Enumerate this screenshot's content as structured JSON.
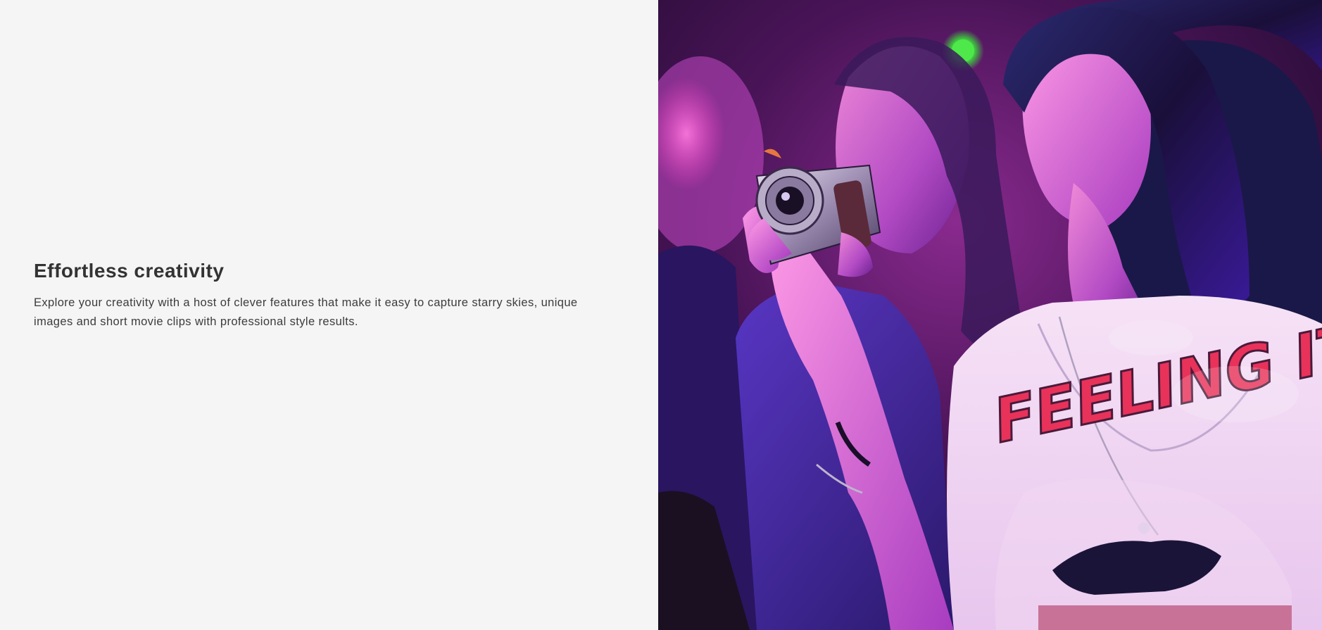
{
  "feature": {
    "title": "Effortless creativity",
    "body": "Explore your creativity with a host of clever features that make it easy to capture starry skies, unique images and short movie clips with professional style results."
  },
  "image": {
    "alt": "Woman at a concert holding a compact camera, lit by pink and purple stage lights",
    "shirt_print": "FEELING IT"
  },
  "colors": {
    "page_background": "#f4f5f4",
    "heading": "#333333",
    "body_text": "#3c3c3c",
    "stage_pink": "#ff3fc8",
    "stage_purple": "#6a1fd0",
    "stage_green": "#3bdc3a"
  }
}
